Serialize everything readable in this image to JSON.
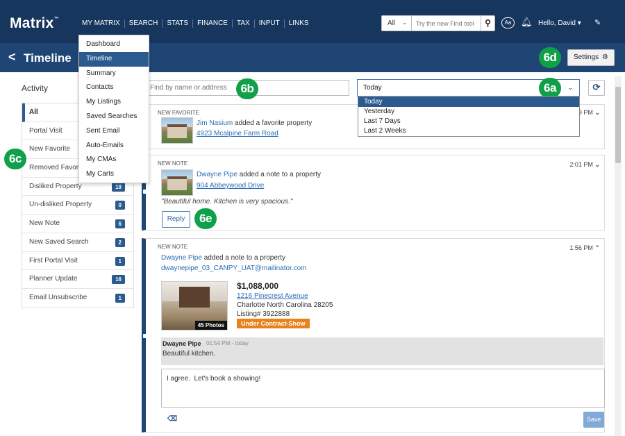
{
  "app": {
    "logo": "Matrix",
    "logo_tm": "™",
    "nav": [
      "MY MATRIX",
      "SEARCH",
      "STATS",
      "FINANCE",
      "TAX",
      "INPUT",
      "LINKS"
    ],
    "search_scope": "All",
    "search_placeholder": "Try the new Find tool",
    "aa_label": "Aa",
    "user_greeting": "Hello, David"
  },
  "my_matrix_menu": [
    "Dashboard",
    "Timeline",
    "Summary",
    "Contacts",
    "My Listings",
    "Saved Searches",
    "Sent Email",
    "Auto-Emails",
    "My CMAs",
    "My Carts"
  ],
  "my_matrix_menu_active": "Timeline",
  "titlebar": {
    "title": "Timeline",
    "settings_label": "Settings"
  },
  "callouts": {
    "a": "6a",
    "b": "6b",
    "c": "6c",
    "d": "6d",
    "e": "6e"
  },
  "sidebar": {
    "title": "Activity",
    "items": [
      {
        "label": "All",
        "count": ""
      },
      {
        "label": "Portal Visit",
        "count": ""
      },
      {
        "label": "New Favorite",
        "count": ""
      },
      {
        "label": "Removed Favorite",
        "count": ""
      },
      {
        "label": "Disliked Property",
        "count": "19"
      },
      {
        "label": "Un-disliked Property",
        "count": "0"
      },
      {
        "label": "New Note",
        "count": "6"
      },
      {
        "label": "New Saved Search",
        "count": "2"
      },
      {
        "label": "First Portal Visit",
        "count": "1"
      },
      {
        "label": "Planner Update",
        "count": "16"
      },
      {
        "label": "Email Unsubscribe",
        "count": "1"
      }
    ]
  },
  "filters": {
    "name_placeholder": "Find by name or address",
    "date_selected": "Today",
    "date_options": [
      "Today",
      "Yesterday",
      "Last 7 Days",
      "Last 2 Weeks"
    ]
  },
  "cards": [
    {
      "tag": "NEW FAVORITE",
      "time": "2:49 PM",
      "contact": "Jim Nasium",
      "action": " added a favorite property",
      "address": "4923 Mcalpine Farm Road"
    },
    {
      "tag": "NEW NOTE",
      "time": "2:01 PM",
      "contact": "Dwayne Pipe",
      "action": " added a note to a property",
      "address": "904 Abbeywood Drive",
      "note": "\"Beautiful home. Kitchen is very spacious.\"",
      "reply_label": "Reply"
    },
    {
      "tag": "NEW NOTE",
      "time": "1:56 PM",
      "contact": "Dwayne Pipe",
      "action": " added a note to a property",
      "email": "dwaynepipe_03_CANPY_UAT@mailinator.com",
      "price": "$1,088,000",
      "address": "1216 Pinecrest Avenue",
      "city_line": "Charlotte North Carolina 28205",
      "listing_no": "Listing# 3922888",
      "photos": "45 Photos",
      "status": "Under Contract-Show",
      "comment_author": "Dwayne Pipe",
      "comment_meta": "01:54 PM - today",
      "comment_text": "Beautiful kitchen.",
      "reply_text": "I agree.  Let's book a showing!",
      "save_label": "Save"
    }
  ],
  "colors": {
    "topbar": "#16365e",
    "titlebar": "#1e4574",
    "accent": "#2a5a8e",
    "callout": "#10a04a",
    "status": "#e8821c"
  }
}
